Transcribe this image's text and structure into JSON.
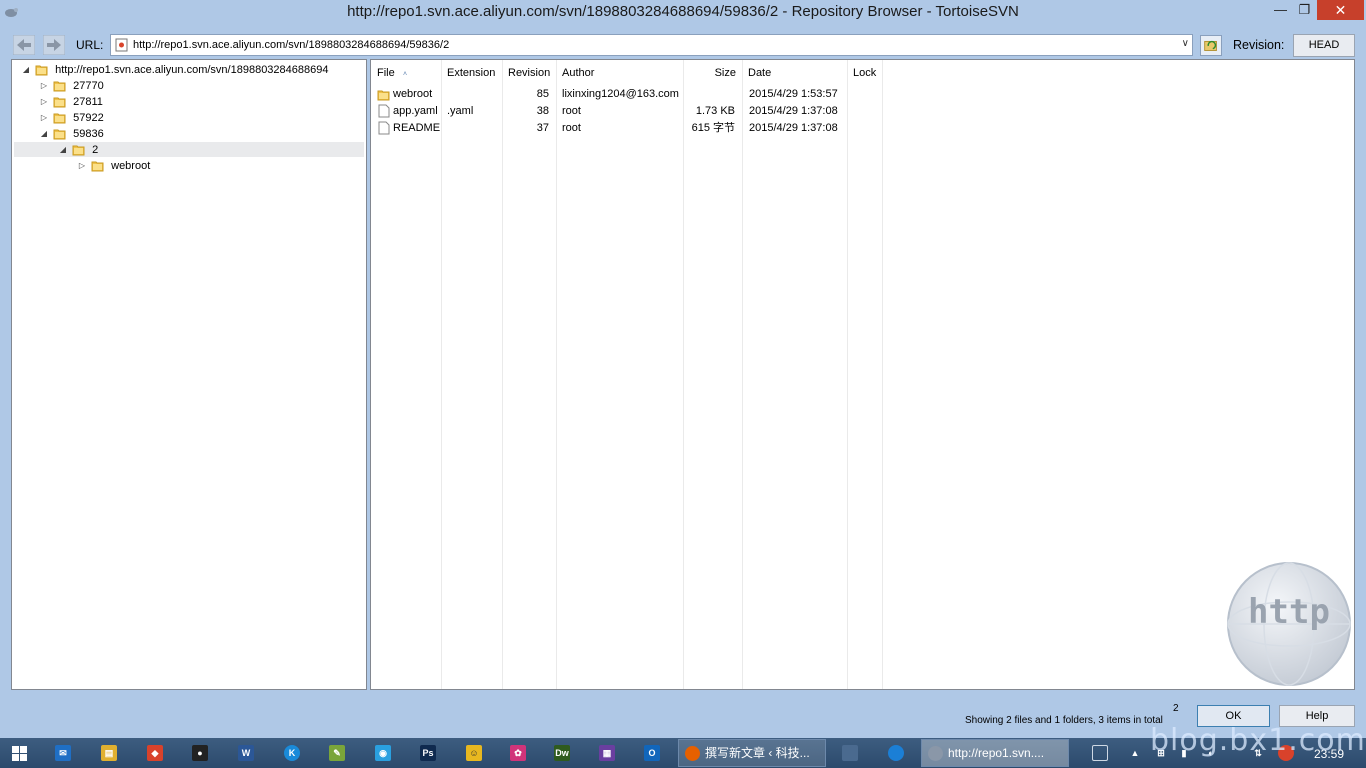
{
  "window": {
    "title": "http://repo1.svn.ace.aliyun.com/svn/1898803284688694/59836/2 - Repository Browser - TortoiseSVN",
    "minimize": "—",
    "restore": "❐",
    "close": "✕"
  },
  "toolbar": {
    "url_label": "URL:",
    "url_value": "http://repo1.svn.ace.aliyun.com/svn/1898803284688694/59836/2",
    "revision_label": "Revision:",
    "revision_value": "HEAD",
    "dropdown_glyph": "∨"
  },
  "tree": {
    "root": "http://repo1.svn.ace.aliyun.com/svn/1898803284688694",
    "items": [
      {
        "label": "27770",
        "expander": "▷"
      },
      {
        "label": "27811",
        "expander": "▷"
      },
      {
        "label": "57922",
        "expander": "▷"
      },
      {
        "label": "59836",
        "expander": "◢"
      },
      {
        "label": "2",
        "expander": "◢"
      },
      {
        "label": "webroot",
        "expander": "▷"
      }
    ],
    "root_expander": "◢"
  },
  "list": {
    "columns": [
      "File",
      "Extension",
      "Revision",
      "Author",
      "Size",
      "Date",
      "Lock"
    ],
    "sort_indicator": "˄",
    "rows": [
      {
        "file": "webroot",
        "extension": "",
        "revision": "85",
        "author": "lixinxing1204@163.com",
        "size": "",
        "date": "2015/4/29 1:53:57",
        "lock": "",
        "icon": "folder"
      },
      {
        "file": "app.yaml",
        "extension": ".yaml",
        "revision": "38",
        "author": "root",
        "size": "1.73 KB",
        "date": "2015/4/29 1:37:08",
        "lock": "",
        "icon": "file"
      },
      {
        "file": "README",
        "extension": "",
        "revision": "37",
        "author": "root",
        "size": "615 字节",
        "date": "2015/4/29 1:37:08",
        "lock": "",
        "icon": "file"
      }
    ]
  },
  "watermark": {
    "text": "http"
  },
  "status": {
    "count": "2",
    "summary": "Showing 2 files and 1 folders, 3 items in total"
  },
  "buttons": {
    "ok": "OK",
    "help": "Help"
  },
  "taskbar": {
    "apps": [
      {
        "label": "撰写新文章 ‹ 科技...",
        "icon": "firefox-icon"
      },
      {
        "label": "http://repo1.svn....",
        "icon": "tortoisesvn-icon"
      }
    ],
    "pinned": [
      {
        "name": "mail-icon",
        "glyph": "✉",
        "color": "#1f6fc5"
      },
      {
        "name": "explorer-icon",
        "glyph": "▤",
        "color": "#e0b030"
      },
      {
        "name": "git-icon",
        "glyph": "◆",
        "color": "#d9422b"
      },
      {
        "name": "qq-icon",
        "glyph": "●",
        "color": "#222222"
      },
      {
        "name": "word-icon",
        "glyph": "W",
        "color": "#2b5797"
      },
      {
        "name": "kugou-icon",
        "glyph": "K",
        "color": "#1a8ad9"
      },
      {
        "name": "notepad-icon",
        "glyph": "✎",
        "color": "#7aa53a"
      },
      {
        "name": "qqbrowser-icon",
        "glyph": "◉",
        "color": "#2aa0e0"
      },
      {
        "name": "photoshop-icon",
        "glyph": "Ps",
        "color": "#0f2a4f"
      },
      {
        "name": "ftp-icon",
        "glyph": "☺",
        "color": "#e8b820"
      },
      {
        "name": "flower-icon",
        "glyph": "✿",
        "color": "#d1347a"
      },
      {
        "name": "dreamweaver-icon",
        "glyph": "Dw",
        "color": "#2f5b1e"
      },
      {
        "name": "calc-icon",
        "glyph": "▦",
        "color": "#6a3fa0"
      },
      {
        "name": "outlook-icon",
        "glyph": "O",
        "color": "#1166bb"
      }
    ],
    "time": "23:59",
    "blog_watermark": "blog.bx1.com"
  }
}
